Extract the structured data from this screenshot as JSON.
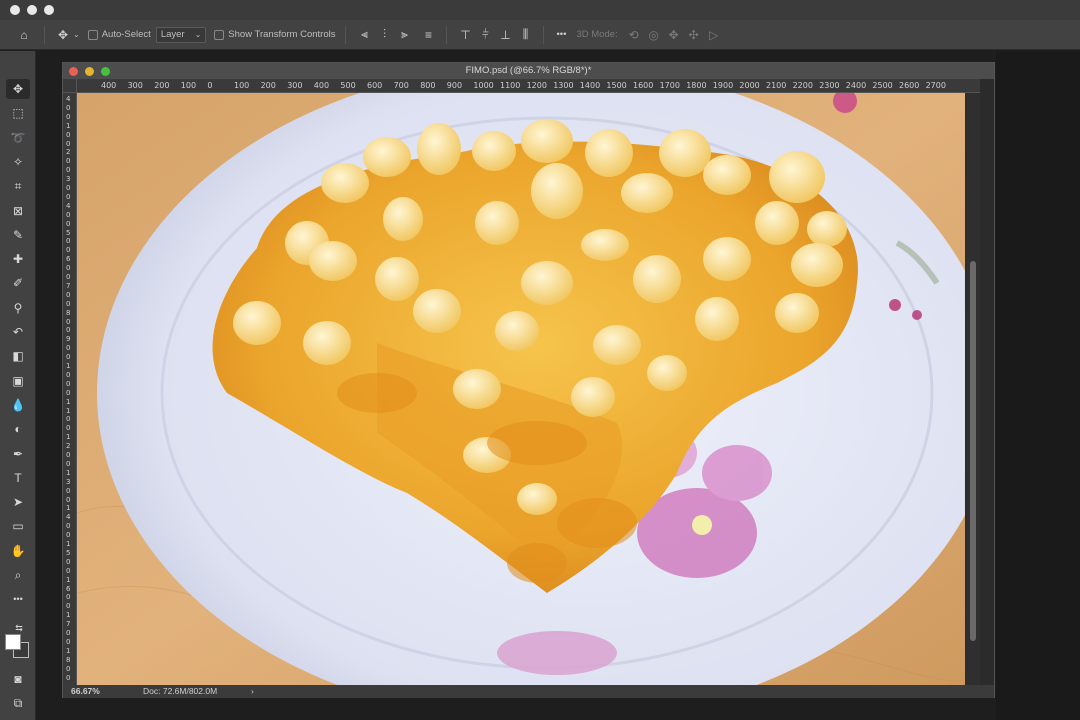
{
  "document": {
    "title": "FIMO.psd (@66.7% RGB/8*)*",
    "zoom": "66.67%",
    "doc_size": "Doc: 72.6M/802.0M"
  },
  "options_bar": {
    "auto_select_label": "Auto-Select",
    "auto_select_target": "Layer",
    "show_transform_label": "Show Transform Controls",
    "more_label": "•••",
    "mode_label": "3D Mode:"
  },
  "rulers": {
    "horizontal": [
      "400",
      "300",
      "200",
      "100",
      "0",
      "100",
      "200",
      "300",
      "400",
      "500",
      "600",
      "700",
      "800",
      "900",
      "1000",
      "1100",
      "1200",
      "1300",
      "1400",
      "1500",
      "1600",
      "1700",
      "1800",
      "1900",
      "2000",
      "2100",
      "2200",
      "2300",
      "2400",
      "2500",
      "2600",
      "2700"
    ],
    "vertical": [
      "4",
      "0",
      "0",
      "1",
      "0",
      "0",
      "2",
      "0",
      "0",
      "3",
      "0",
      "0",
      "4",
      "0",
      "0",
      "5",
      "0",
      "0",
      "6",
      "0",
      "0",
      "7",
      "0",
      "0",
      "8",
      "0",
      "0",
      "9",
      "0",
      "0",
      "1",
      "0",
      "0",
      "0",
      "1",
      "1",
      "0",
      "0",
      "1",
      "2",
      "0",
      "0",
      "1",
      "3",
      "0",
      "0",
      "1",
      "4",
      "0",
      "0",
      "1",
      "5",
      "0",
      "0",
      "1",
      "6",
      "0",
      "0",
      "1",
      "7",
      "0",
      "0",
      "1",
      "8",
      "0",
      "0"
    ]
  },
  "tools": [
    {
      "name": "move-tool-icon",
      "glyph": "✥",
      "active": true
    },
    {
      "name": "marquee-tool-icon",
      "glyph": "⬚"
    },
    {
      "name": "lasso-tool-icon",
      "glyph": "➰"
    },
    {
      "name": "magic-wand-tool-icon",
      "glyph": "✧"
    },
    {
      "name": "crop-tool-icon",
      "glyph": "⌗"
    },
    {
      "name": "frame-tool-icon",
      "glyph": "⊠"
    },
    {
      "name": "eyedropper-tool-icon",
      "glyph": "✎"
    },
    {
      "name": "healing-brush-tool-icon",
      "glyph": "✚"
    },
    {
      "name": "brush-tool-icon",
      "glyph": "✐"
    },
    {
      "name": "stamp-tool-icon",
      "glyph": "⚲"
    },
    {
      "name": "history-brush-tool-icon",
      "glyph": "↶"
    },
    {
      "name": "eraser-tool-icon",
      "glyph": "◧"
    },
    {
      "name": "gradient-tool-icon",
      "glyph": "▣"
    },
    {
      "name": "blur-tool-icon",
      "glyph": "💧"
    },
    {
      "name": "dodge-tool-icon",
      "glyph": "◐"
    },
    {
      "name": "pen-tool-icon",
      "glyph": "✒"
    },
    {
      "name": "type-tool-icon",
      "glyph": "T"
    },
    {
      "name": "path-selection-tool-icon",
      "glyph": "➤"
    },
    {
      "name": "rectangle-tool-icon",
      "glyph": "▭"
    },
    {
      "name": "hand-tool-icon",
      "glyph": "✋"
    },
    {
      "name": "zoom-tool-icon",
      "glyph": "⌕"
    },
    {
      "name": "more-tools-icon",
      "glyph": "•••"
    }
  ],
  "colors": {
    "foreground": "#ffffff",
    "background": "#3a3a3a"
  }
}
